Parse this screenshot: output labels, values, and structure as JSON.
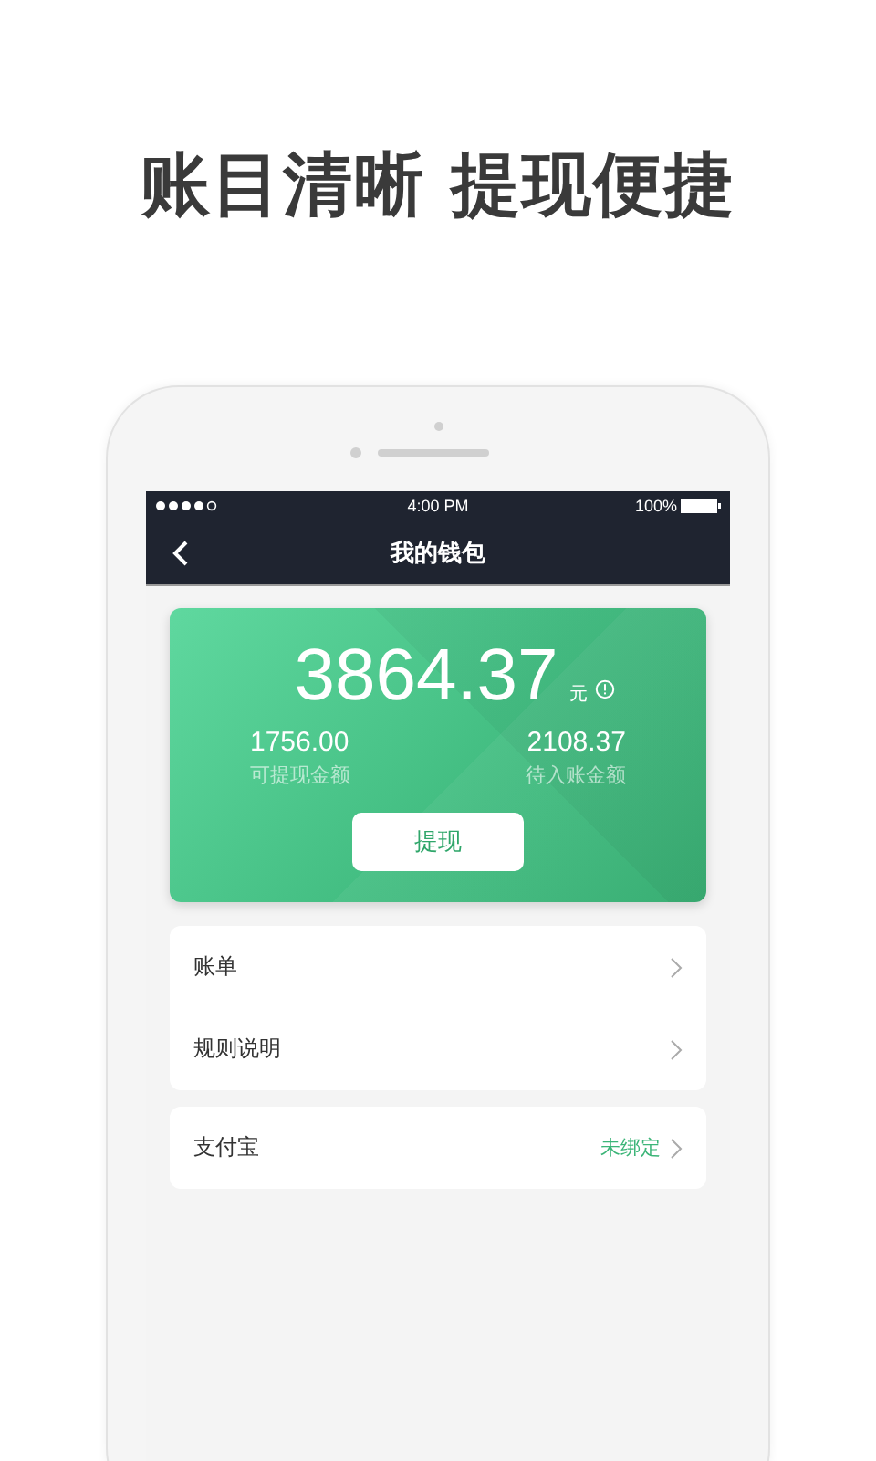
{
  "headline": "账目清晰 提现便捷",
  "status_bar": {
    "time": "4:00 PM",
    "battery": "100%"
  },
  "nav": {
    "title": "我的钱包"
  },
  "balance": {
    "amount": "3864.37",
    "unit": "元",
    "sub": [
      {
        "value": "1756.00",
        "label": "可提现金额"
      },
      {
        "value": "2108.37",
        "label": "待入账金额"
      }
    ],
    "button": "提现"
  },
  "menu_groups": [
    {
      "items": [
        {
          "label": "账单"
        },
        {
          "label": "规则说明"
        }
      ]
    },
    {
      "items": [
        {
          "label": "支付宝",
          "value": "未绑定"
        }
      ]
    }
  ]
}
